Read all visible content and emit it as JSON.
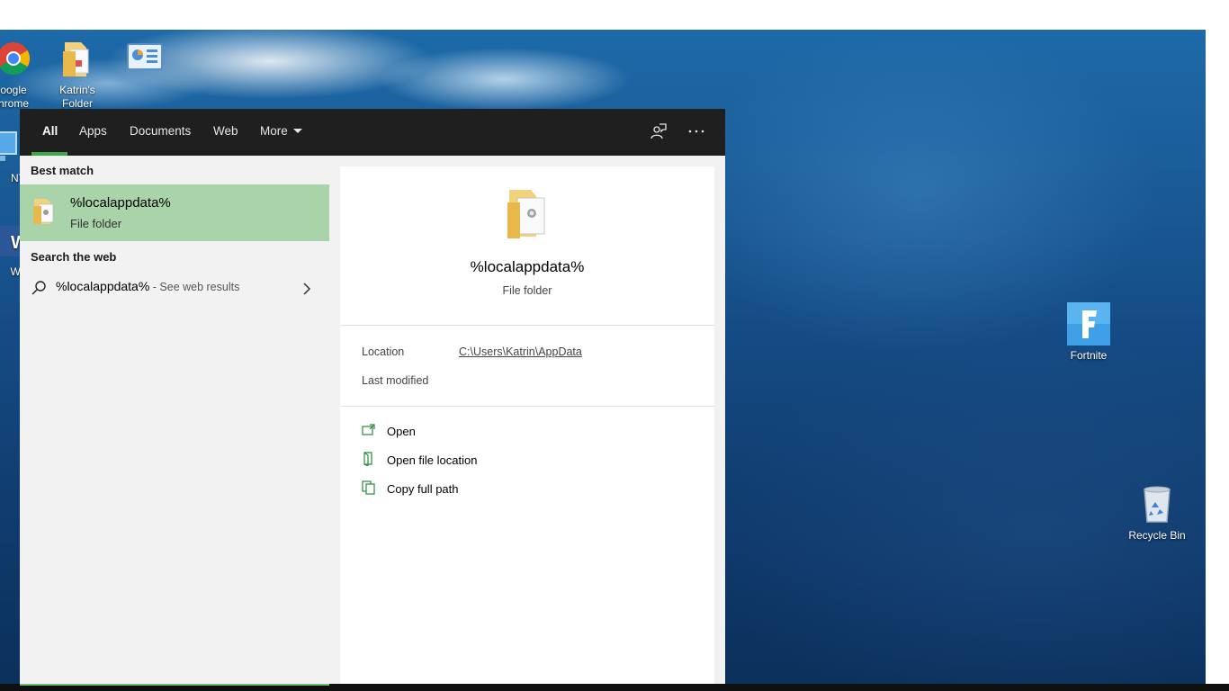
{
  "desktop": {
    "icons": [
      {
        "label_line1": "oogle",
        "label_line2": "hrome",
        "icon": "chrome-icon"
      },
      {
        "label_line1": "Katrin's",
        "label_line2": "Folder",
        "icon": "folder-icon"
      },
      {
        "label_line1": "",
        "label_line2": "",
        "icon": "control-panel-icon"
      },
      {
        "label_line1": "NTIN",
        "label_line2": "",
        "icon": "computer-icon"
      },
      {
        "label_line1": "Word",
        "label_line2": "",
        "icon": "word-icon"
      },
      {
        "label_line1": "Fortnite",
        "label_line2": "",
        "icon": "fortnite-icon"
      },
      {
        "label_line1": "Recycle Bin",
        "label_line2": "",
        "icon": "recycle-bin-icon"
      }
    ]
  },
  "search": {
    "tabs": [
      {
        "label": "All",
        "active": true
      },
      {
        "label": "Apps",
        "active": false
      },
      {
        "label": "Documents",
        "active": false
      },
      {
        "label": "Web",
        "active": false
      },
      {
        "label": "More",
        "active": false
      }
    ],
    "best_match_heading": "Best match",
    "best_match": {
      "title": "%localappdata%",
      "subtitle": "File folder"
    },
    "web_heading": "Search the web",
    "web_result": {
      "query": "%localappdata%",
      "hint": " - See web results"
    },
    "preview": {
      "title": "%localappdata%",
      "subtitle": "File folder",
      "location_label": "Location",
      "location_value": "C:\\Users\\Katrin\\AppData",
      "modified_label": "Last modified",
      "actions": [
        {
          "label": "Open",
          "icon": "open-icon"
        },
        {
          "label": "Open file location",
          "icon": "file-location-icon"
        },
        {
          "label": "Copy full path",
          "icon": "copy-path-icon"
        }
      ]
    }
  },
  "colors": {
    "accent": "#3fa64a",
    "selection": "#a9d3a9",
    "topbar": "#1f1f1f"
  }
}
